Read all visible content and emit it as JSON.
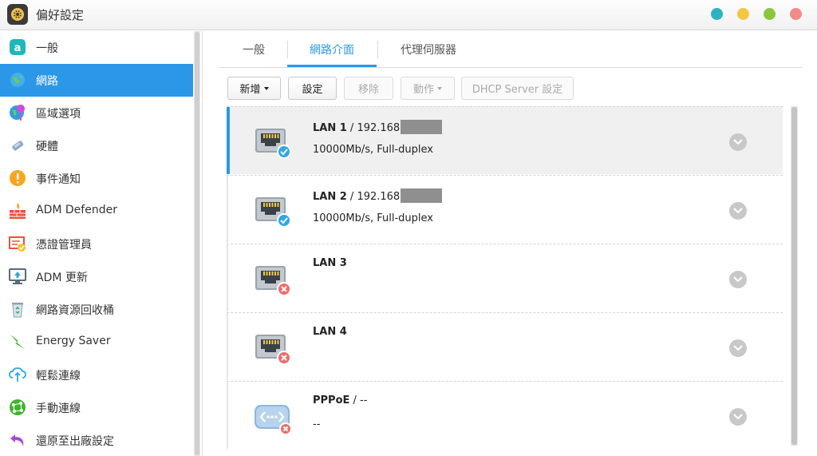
{
  "window": {
    "title": "偏好設定",
    "app_icon": "gear-icon",
    "controls": [
      {
        "name": "teal-dot",
        "color": "#2bb3c0"
      },
      {
        "name": "yellow-dot",
        "color": "#f3c744"
      },
      {
        "name": "green-dot",
        "color": "#8cc63f"
      },
      {
        "name": "red-dot",
        "color": "#f28a8a"
      }
    ]
  },
  "sidebar": {
    "items": [
      {
        "label": "一般",
        "icon": "general-icon",
        "active": false
      },
      {
        "label": "網路",
        "icon": "globe-icon",
        "active": true
      },
      {
        "label": "區域選項",
        "icon": "region-icon",
        "active": false
      },
      {
        "label": "硬體",
        "icon": "hardware-icon",
        "active": false
      },
      {
        "label": "事件通知",
        "icon": "notification-icon",
        "active": false
      },
      {
        "label": "ADM Defender",
        "icon": "firewall-icon",
        "active": false
      },
      {
        "label": "憑證管理員",
        "icon": "certificate-icon",
        "active": false
      },
      {
        "label": "ADM 更新",
        "icon": "update-icon",
        "active": false
      },
      {
        "label": "網路資源回收桶",
        "icon": "recycle-icon",
        "active": false
      },
      {
        "label": "Energy Saver",
        "icon": "energy-icon",
        "active": false
      },
      {
        "label": "輕鬆連線",
        "icon": "cloud-connect-icon",
        "active": false
      },
      {
        "label": "手動連線",
        "icon": "manual-connect-icon",
        "active": false
      },
      {
        "label": "還原至出廠設定",
        "icon": "restore-icon",
        "active": false
      }
    ]
  },
  "tabs": [
    {
      "label": "一般",
      "active": false
    },
    {
      "label": "網路介面",
      "active": true
    },
    {
      "label": "代理伺服器",
      "active": false
    }
  ],
  "toolbar": {
    "add_label": "新增",
    "settings_label": "設定",
    "remove_label": "移除",
    "action_label": "動作",
    "dhcp_label": "DHCP Server 設定"
  },
  "interfaces": [
    {
      "name": "LAN 1",
      "ip": " / 192.168",
      "desc": "10000Mb/s, Full-duplex",
      "status": "connected",
      "icon": "ethernet-port-icon",
      "selected": true
    },
    {
      "name": "LAN 2",
      "ip": " / 192.168",
      "desc": "10000Mb/s, Full-duplex",
      "status": "connected",
      "icon": "ethernet-port-icon",
      "selected": false
    },
    {
      "name": "LAN 3",
      "ip": "",
      "desc": "",
      "status": "disconnected",
      "icon": "ethernet-port-icon",
      "selected": false
    },
    {
      "name": "LAN 4",
      "ip": "",
      "desc": "",
      "status": "disconnected",
      "icon": "ethernet-port-icon",
      "selected": false
    },
    {
      "name": "PPPoE",
      "ip": " / --",
      "desc": "--",
      "status": "disconnected",
      "icon": "pppoe-icon",
      "selected": false
    }
  ],
  "colors": {
    "accent": "#2b97e6",
    "ok": "#2fa7e8",
    "error": "#ef6b6b"
  }
}
